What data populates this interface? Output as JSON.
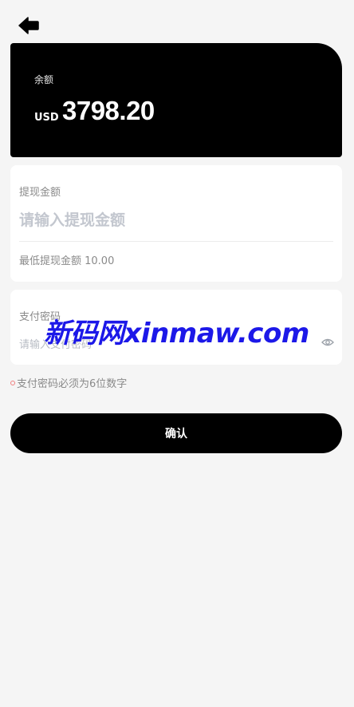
{
  "header": {
    "back_icon": "arrow-left-icon"
  },
  "balance": {
    "label": "余额",
    "currency": "USD",
    "amount": "3798.20"
  },
  "withdraw": {
    "label": "提现金额",
    "placeholder": "请输入提现金额",
    "min_text": "最低提现金额 10.00"
  },
  "password": {
    "label": "支付密码",
    "placeholder": "请输入支付密码",
    "eye_icon": "eye-icon"
  },
  "hint": {
    "text": "支付密码必须为6位数字"
  },
  "confirm": {
    "label": "确认"
  },
  "watermark": {
    "text": "新码网xinmaw.com"
  },
  "colors": {
    "background": "#f5f5f5",
    "card": "#ffffff",
    "primary": "#000000",
    "watermark": "#1c18e8"
  }
}
